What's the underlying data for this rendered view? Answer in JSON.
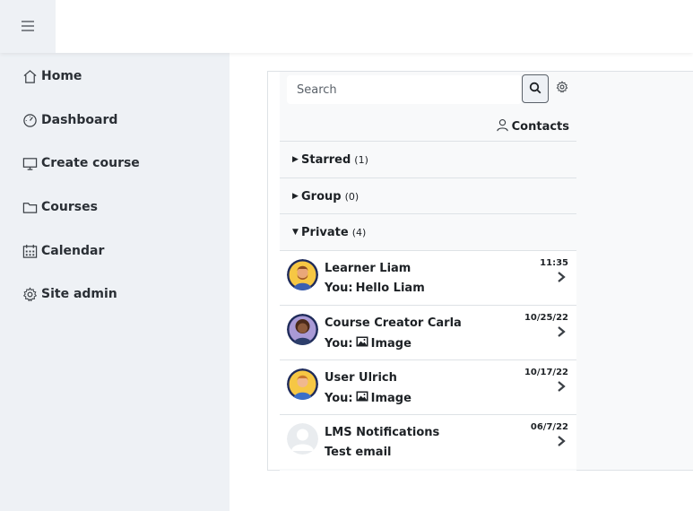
{
  "header": {
    "menu_icon": "hamburger-icon"
  },
  "sidebar": {
    "items": [
      {
        "label": "Home",
        "icon": "home-icon"
      },
      {
        "label": "Dashboard",
        "icon": "dashboard-icon"
      },
      {
        "label": "Create course",
        "icon": "monitor-icon"
      },
      {
        "label": "Courses",
        "icon": "folder-icon"
      },
      {
        "label": "Calendar",
        "icon": "calendar-icon"
      },
      {
        "label": "Site admin",
        "icon": "gear-icon"
      }
    ]
  },
  "messages": {
    "search": {
      "placeholder": "Search",
      "value": ""
    },
    "contacts_label": "Contacts",
    "sections": [
      {
        "label": "Starred",
        "count": "(1)",
        "expanded": false
      },
      {
        "label": "Group",
        "count": "(0)",
        "expanded": false
      },
      {
        "label": "Private",
        "count": "(4)",
        "expanded": true
      }
    ],
    "conversations": [
      {
        "name": "Learner Liam",
        "prefix": "You:",
        "text": "Hello Liam",
        "has_image": false,
        "time": "11:35"
      },
      {
        "name": "Course Creator Carla",
        "prefix": "You:",
        "text": "Image",
        "has_image": true,
        "time": "10/25/22"
      },
      {
        "name": "User Ulrich",
        "prefix": "You:",
        "text": "Image",
        "has_image": true,
        "time": "10/17/22"
      },
      {
        "name": "LMS Notifications",
        "prefix": "",
        "text": "Test email",
        "has_image": false,
        "time": "06/7/22"
      }
    ]
  },
  "colors": {
    "sidebar_bg": "#eef1f5",
    "text": "#1d2125",
    "border": "#dee2e6",
    "panel_bg": "#f8f9fa"
  }
}
